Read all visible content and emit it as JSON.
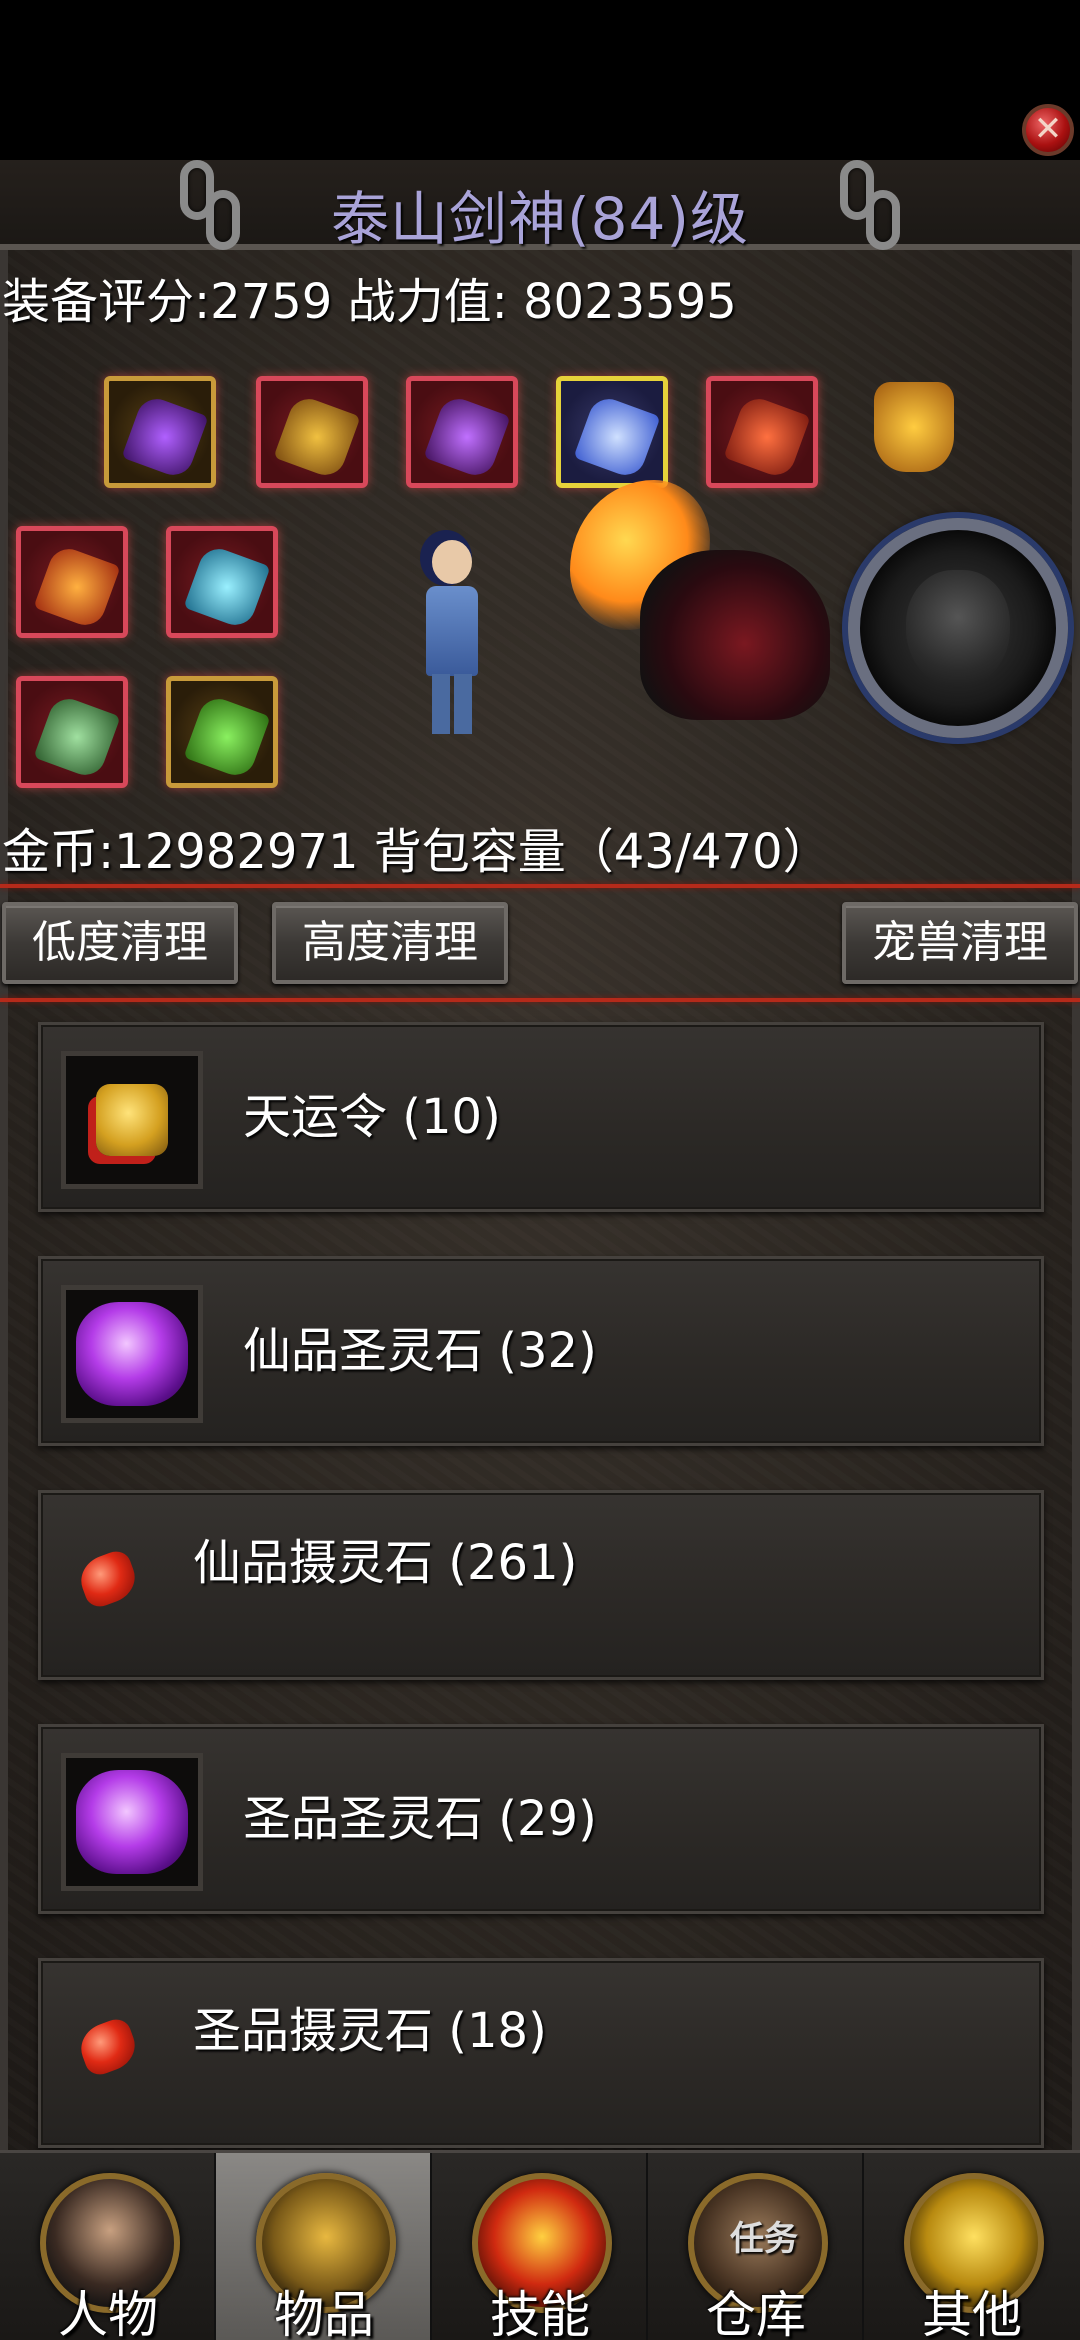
{
  "header": {
    "title": "泰山剑神(84)级",
    "close_icon": "close-icon"
  },
  "stats": {
    "line": "装备评分:2759 战力值:  8023595",
    "money_line": "金币:12982971 背包容量（43/470）"
  },
  "actions": {
    "low_clean": "低度清理",
    "high_clean": "高度清理",
    "pet_clean": "宠兽清理"
  },
  "items": [
    {
      "label": "天运令 (10)",
      "icon": "token-icon"
    },
    {
      "label": "仙品圣灵石 (32)",
      "icon": "purple-spirit-stone-icon"
    },
    {
      "label": "仙品摄灵石 (261)",
      "icon": "red-gem-icon"
    },
    {
      "label": "圣品圣灵石 (29)",
      "icon": "purple-spirit-stone-icon"
    },
    {
      "label": "圣品摄灵石 (18)",
      "icon": "red-gem-icon"
    }
  ],
  "nav": {
    "items": [
      {
        "label": "人物",
        "icon": "character-icon"
      },
      {
        "label": "物品",
        "icon": "items-icon"
      },
      {
        "label": "技能",
        "icon": "skills-icon"
      },
      {
        "label": "仓库",
        "icon": "warehouse-icon",
        "overlay": "任务"
      },
      {
        "label": "其他",
        "icon": "other-icon"
      }
    ],
    "active_index": 1
  },
  "colors": {
    "title": "#a9a3d8",
    "divider": "#b52a1a",
    "active_tab": "#7a7875"
  }
}
